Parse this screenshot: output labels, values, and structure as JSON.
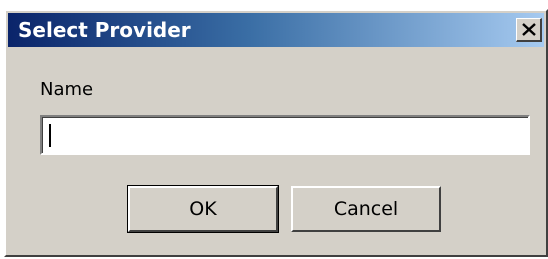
{
  "dialog": {
    "title": "Select Provider",
    "close_icon": "close-icon"
  },
  "form": {
    "name_label": "Name",
    "name_value": "",
    "name_placeholder": ""
  },
  "buttons": {
    "ok_label": "OK",
    "cancel_label": "Cancel"
  },
  "colors": {
    "titlebar_start": "#0a246a",
    "titlebar_end": "#a6caf0",
    "dialog_face": "#d4d0c8"
  }
}
